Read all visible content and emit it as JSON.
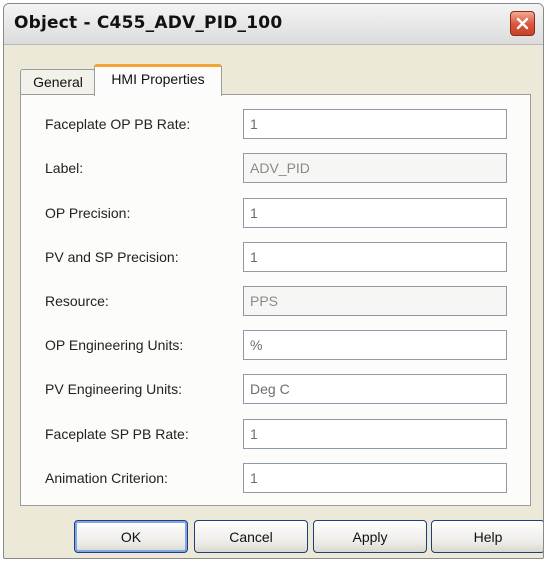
{
  "window": {
    "title": "Object - C455_ADV_PID_100"
  },
  "tabs": [
    {
      "label": "General",
      "selected": false
    },
    {
      "label": "HMI Properties",
      "selected": true
    }
  ],
  "fields": [
    {
      "label": "Faceplate OP PB Rate:",
      "value": "1"
    },
    {
      "label": "Label:",
      "value": "ADV_PID"
    },
    {
      "label": "OP Precision:",
      "value": "1"
    },
    {
      "label": "PV and SP Precision:",
      "value": "1"
    },
    {
      "label": "Resource:",
      "value": "PPS"
    },
    {
      "label": "OP Engineering Units:",
      "value": "%"
    },
    {
      "label": "PV Engineering Units:",
      "value": "Deg C"
    },
    {
      "label": "Faceplate SP PB Rate:",
      "value": "1"
    },
    {
      "label": "Animation Criterion:",
      "value": "1"
    }
  ],
  "buttons": {
    "ok": "OK",
    "cancel": "Cancel",
    "apply": "Apply",
    "help": "Help"
  },
  "icons": {
    "close": "close-icon"
  },
  "colors": {
    "close_button": "#d9543a",
    "selected_tab_accent": "#f2a334",
    "default_button_border": "#7fa6e6"
  }
}
